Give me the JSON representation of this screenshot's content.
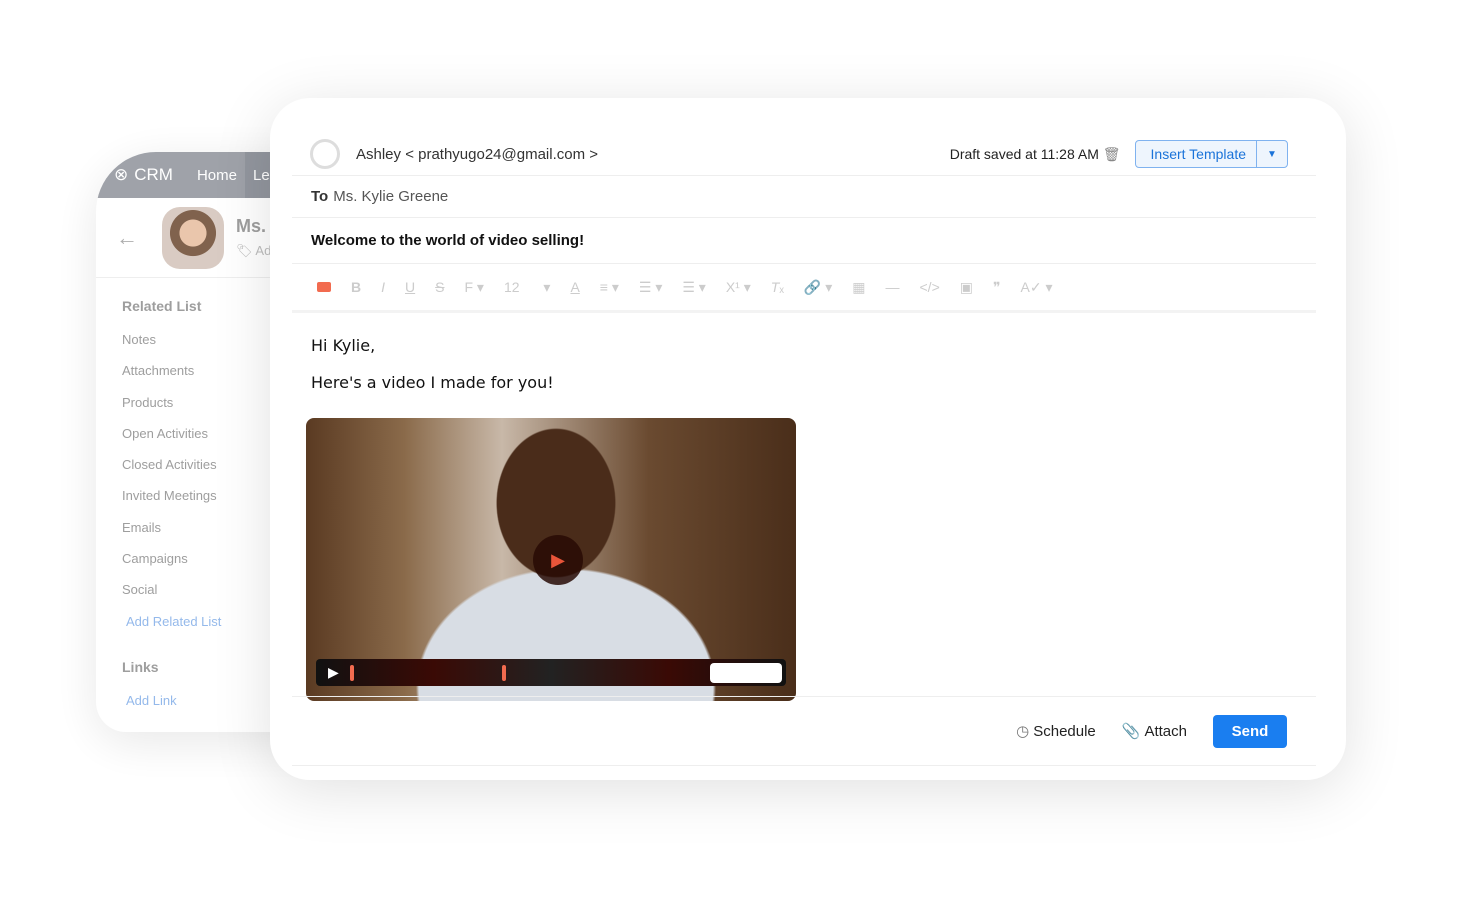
{
  "crm": {
    "logo": "CRM",
    "tabs": [
      "Home",
      "Le"
    ],
    "record_name": "Ms. K",
    "record_tag": "Add",
    "related_title": "Related List",
    "related_items": [
      "Notes",
      "Attachments",
      "Products",
      "Open Activities",
      "Closed Activities",
      "Invited Meetings",
      "Emails",
      "Campaigns",
      "Social"
    ],
    "add_related": "Add Related List",
    "links_title": "Links",
    "add_link": "Add Link"
  },
  "email": {
    "from": "Ashley < prathyugo24@gmail.com >",
    "draft_status": "Draft saved at 11:28 AM",
    "insert_template": "Insert Template",
    "to_label": "To",
    "to_value": "Ms. Kylie Greene",
    "subject": "Welcome to the world of video selling!",
    "toolbar": {
      "font_size": "12"
    },
    "body_lines": [
      "Hi Kylie,",
      "Here's a video I made for you!"
    ],
    "schedule": "Schedule",
    "attach": "Attach",
    "send": "Send"
  },
  "colors": {
    "accent": "#1a7ef0",
    "video_icon": "#f26b4f"
  }
}
